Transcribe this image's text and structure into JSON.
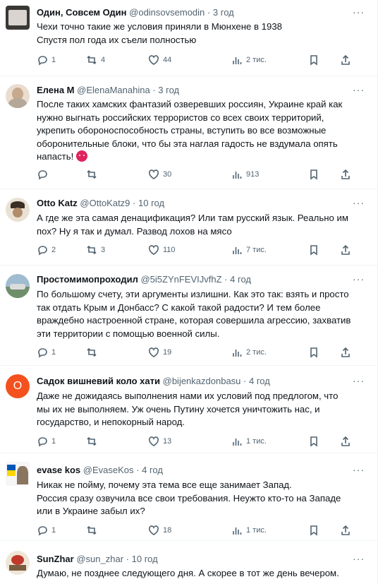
{
  "tweets": [
    {
      "name": "Один, Совсем Один",
      "handle": "@odinsovsemodin",
      "sep": "·",
      "time": "3 год",
      "lines": [
        "Чехи точно такие же условия приняли в Мюнхене в 1938",
        "Спустя пол года их съели полностью"
      ],
      "replies": "1",
      "reposts": "4",
      "likes": "44",
      "views": "2 тис.",
      "avatar_color": "#6d6a66"
    },
    {
      "name": "Елена М",
      "handle": "@ElenaManahina",
      "sep": "·",
      "time": "3 год",
      "lines": [
        "После таких хамских фантазий озверевших россиян, Украине край как",
        "нужно выгнать российских террористов со всех своих территорий,",
        "укрепить обороноспособность страны, вступить во все возможные",
        "оборонительные блоки, что бы эта наглая гадость не вздумала опять",
        "напасть!"
      ],
      "emoji": "pouting-face-icon",
      "replies": "",
      "reposts": "",
      "likes": "30",
      "views": "913",
      "avatar_color": "#d9c4b1"
    },
    {
      "name": "Otto Katz",
      "handle": "@OttoKatz9",
      "sep": "·",
      "time": "10 год",
      "lines": [
        "А где же эта самая денацификация? Или там русский язык. Реально им",
        "пох? Ну я так и думал. Развод лохов на мясо"
      ],
      "replies": "2",
      "reposts": "3",
      "likes": "110",
      "views": "7 тис.",
      "avatar_color": "#8b7a66"
    },
    {
      "name": "Простомимопроходил",
      "handle": "@5i5ZYnFEVIJvfhZ",
      "sep": "·",
      "time": "4 год",
      "lines": [
        "По большому счету, эти аргументы излишни. Как это так: взять и просто",
        "так отдать Крым и Донбасс? С какой такой радости? И тем более",
        "враждебно настроенной стране, которая совершила агрессию, захватив",
        "эти территории с помощью военной силы."
      ],
      "replies": "1",
      "reposts": "",
      "likes": "19",
      "views": "2 тис.",
      "avatar_color": "#6f8f6a"
    },
    {
      "name": "Садок вишневий коло хати",
      "handle": "@bijenkazdonbasu",
      "sep": "·",
      "time": "4 год",
      "lines": [
        "Даже не дожидаясь выполнения нами их условий под предлогом, что",
        "мы их не выполняем. Уж очень Путину хочется уничтожить нас, и",
        "государство, и непокорный народ."
      ],
      "replies": "1",
      "reposts": "",
      "likes": "13",
      "views": "1 тис.",
      "avatar_color": "#f4511e",
      "avatar_letter": "О"
    },
    {
      "name": "evase kos",
      "handle": "@EvaseKos",
      "sep": "·",
      "time": "4 год",
      "lines": [
        "Никак не пойму, почему эта тема все еще занимает Запад.",
        "Россия сразу озвучила все свои требования. Неужто кто-то на Западе",
        "или в Украине забыл их?"
      ],
      "replies": "1",
      "reposts": "",
      "likes": "18",
      "views": "1 тис.",
      "avatar_color": "#2a6fd6"
    },
    {
      "name": "SunZhar",
      "handle": "@sun_zhar",
      "sep": "·",
      "time": "10 год",
      "lines": [
        "Думаю, не позднее следующего дня. А скорее в тот же день вечером."
      ],
      "replies": "",
      "reposts": "",
      "likes": "",
      "views": "",
      "avatar_color": "#c0392b"
    }
  ],
  "more_label": "···"
}
